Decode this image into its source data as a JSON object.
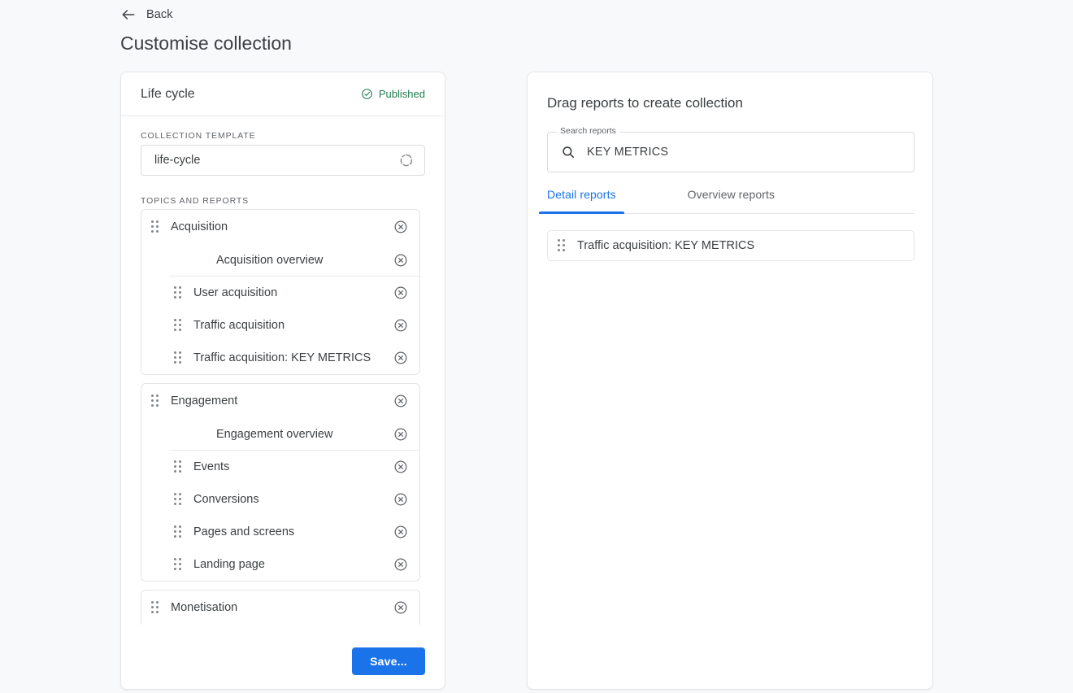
{
  "header": {
    "back_label": "Back",
    "back_icon": "arrow-left-icon",
    "page_title": "Customise collection"
  },
  "left_panel": {
    "title": "Life cycle",
    "status": {
      "label": "Published",
      "icon": "check-circle-icon",
      "color": "#1e7b4e"
    },
    "template_section_label": "COLLECTION TEMPLATE",
    "template_value": "life-cycle",
    "template_icon": "loading-spinner-icon",
    "topics_section_label": "TOPICS AND REPORTS",
    "remove_icon": "close-circle-icon",
    "drag_icon": "drag-handle-icon",
    "groups": [
      {
        "topic": "Acquisition",
        "items": [
          {
            "label": "Acquisition overview",
            "draggable": false,
            "divider_after": true
          },
          {
            "label": "User acquisition",
            "draggable": true,
            "divider_after": false
          },
          {
            "label": "Traffic acquisition",
            "draggable": true,
            "divider_after": false
          },
          {
            "label": "Traffic acquisition: KEY METRICS",
            "draggable": true,
            "divider_after": false
          }
        ]
      },
      {
        "topic": "Engagement",
        "items": [
          {
            "label": "Engagement overview",
            "draggable": false,
            "divider_after": true
          },
          {
            "label": "Events",
            "draggable": true,
            "divider_after": false
          },
          {
            "label": "Conversions",
            "draggable": true,
            "divider_after": false
          },
          {
            "label": "Pages and screens",
            "draggable": true,
            "divider_after": false
          },
          {
            "label": "Landing page",
            "draggable": true,
            "divider_after": false
          }
        ]
      },
      {
        "topic": "Monetisation",
        "items": []
      }
    ],
    "save_label": "Save...",
    "save_color": "#1a73e8"
  },
  "right_panel": {
    "title": "Drag reports to create collection",
    "search": {
      "legend": "Search reports",
      "value": "KEY METRICS",
      "placeholder": "Search reports",
      "icon": "search-icon"
    },
    "tabs": [
      {
        "label": "Detail reports",
        "active": true
      },
      {
        "label": "Overview reports",
        "active": false
      }
    ],
    "results": [
      {
        "label": "Traffic acquisition: KEY METRICS",
        "icon": "drag-handle-icon"
      }
    ]
  }
}
